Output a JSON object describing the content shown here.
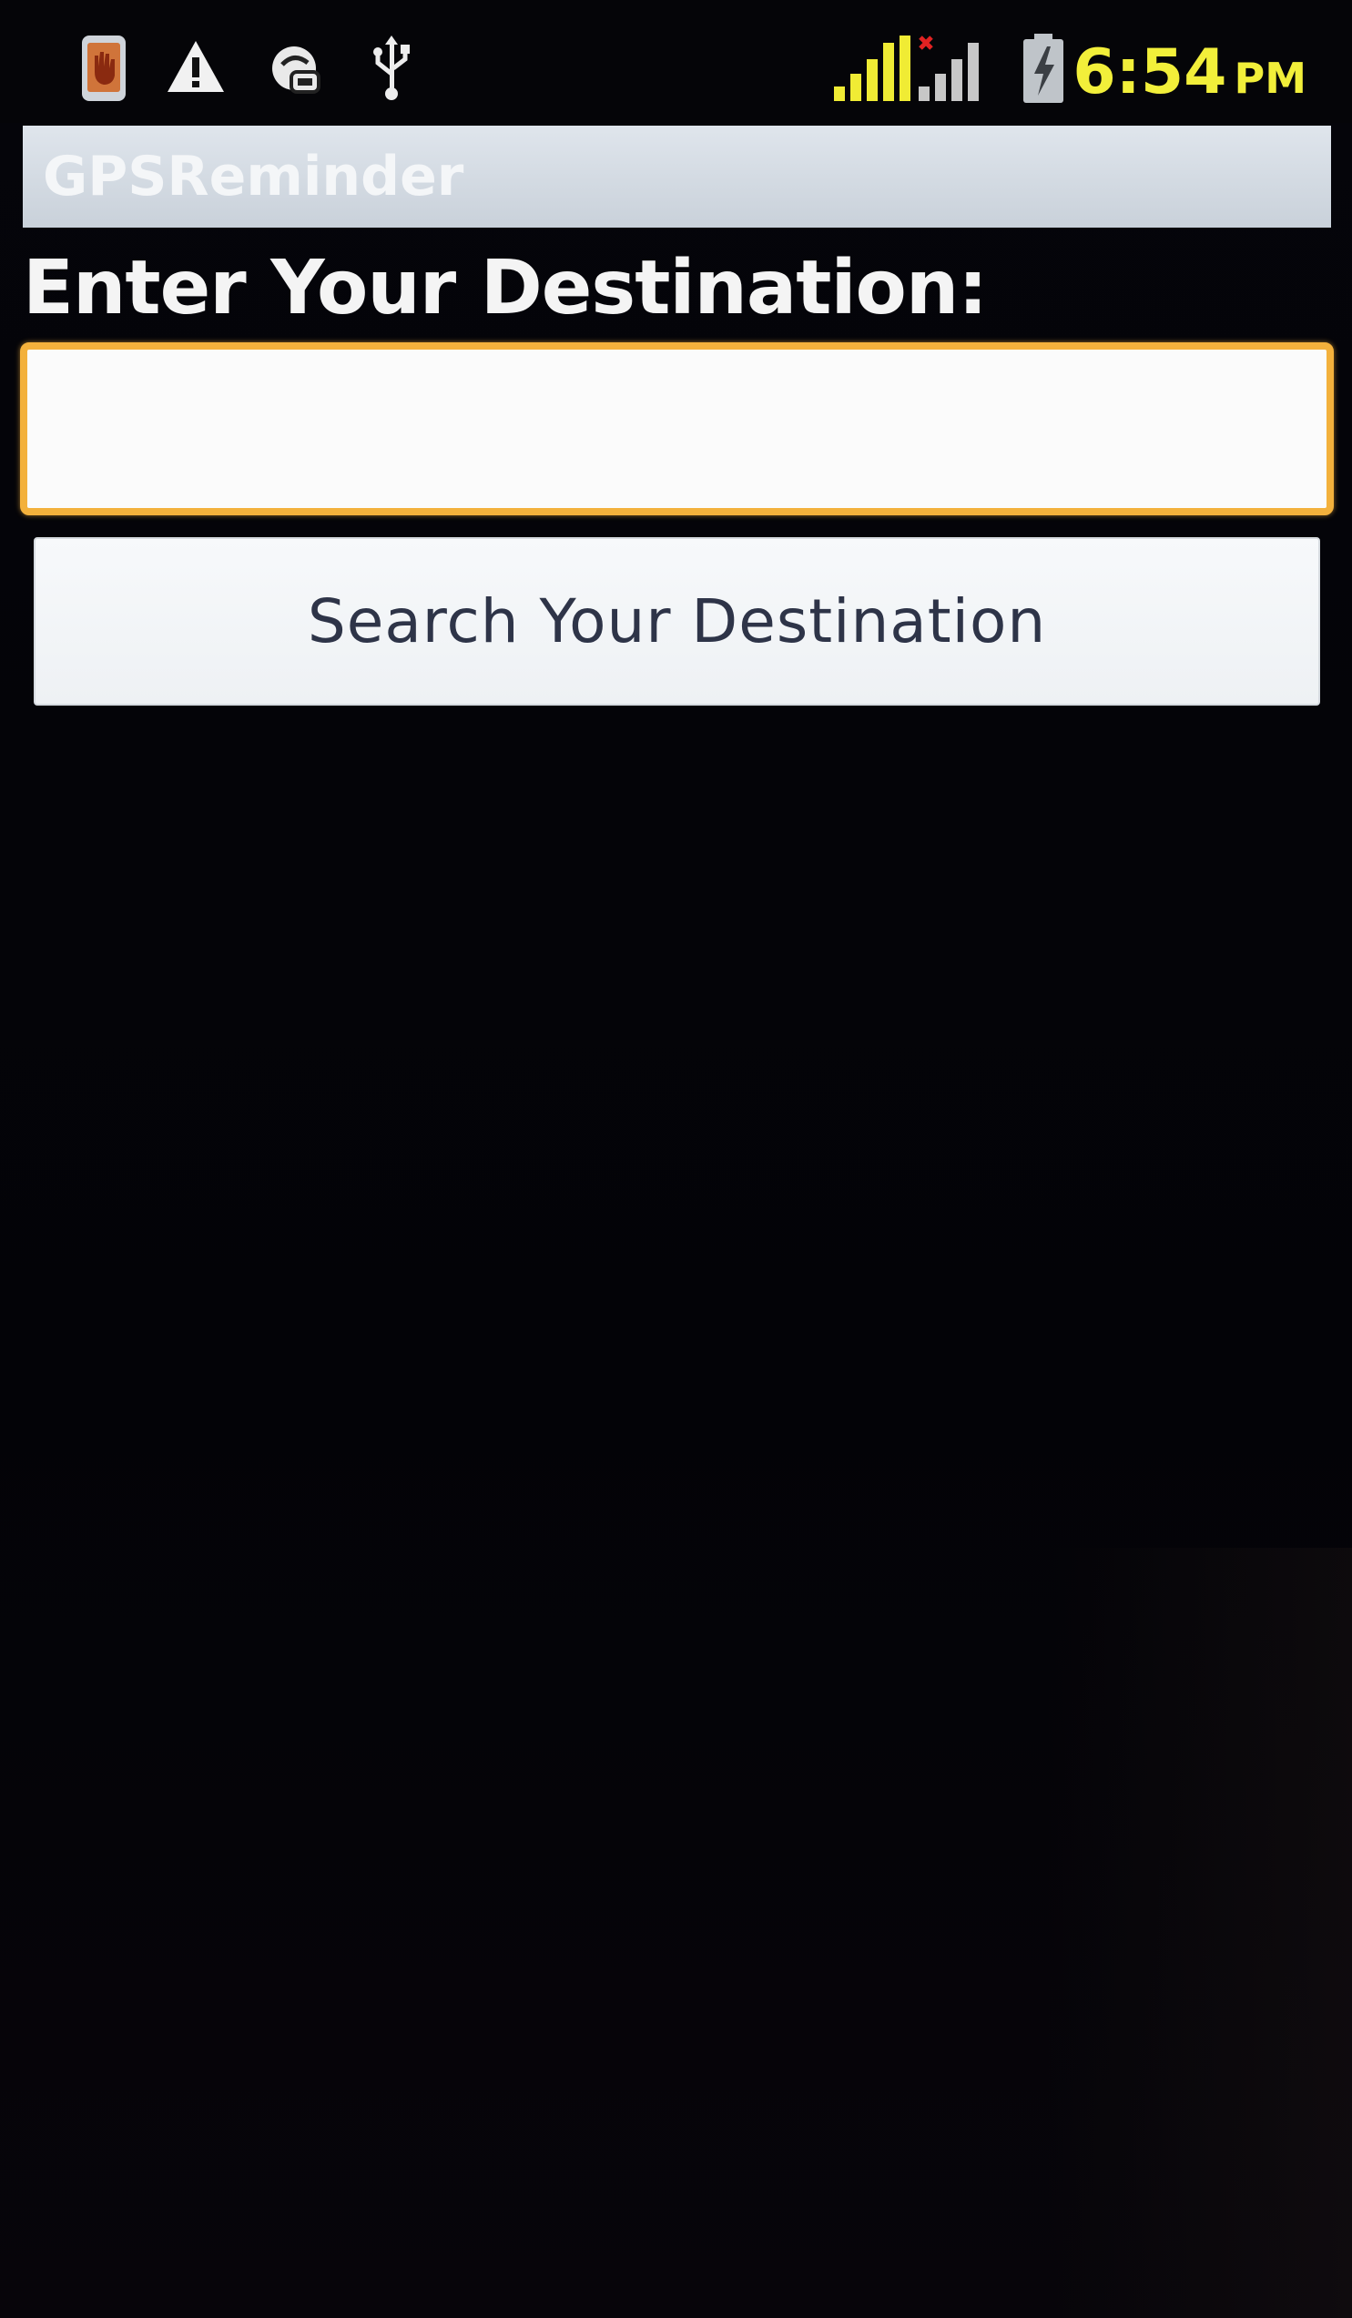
{
  "status_bar": {
    "icons": [
      "app-notification-icon",
      "warning-icon",
      "data-sync-icon",
      "usb-icon",
      "signal-strength-icon",
      "no-signal-icon",
      "battery-charging-icon"
    ],
    "time": "6:54",
    "am_pm": "PM",
    "accent_color": "#f2ef3a"
  },
  "app_bar": {
    "title": "GPSReminder"
  },
  "form": {
    "prompt_label": "Enter Your Destination:",
    "destination_value": "",
    "destination_placeholder": "",
    "focus_color": "#f3b13c",
    "search_button_label": "Search Your Destination"
  }
}
